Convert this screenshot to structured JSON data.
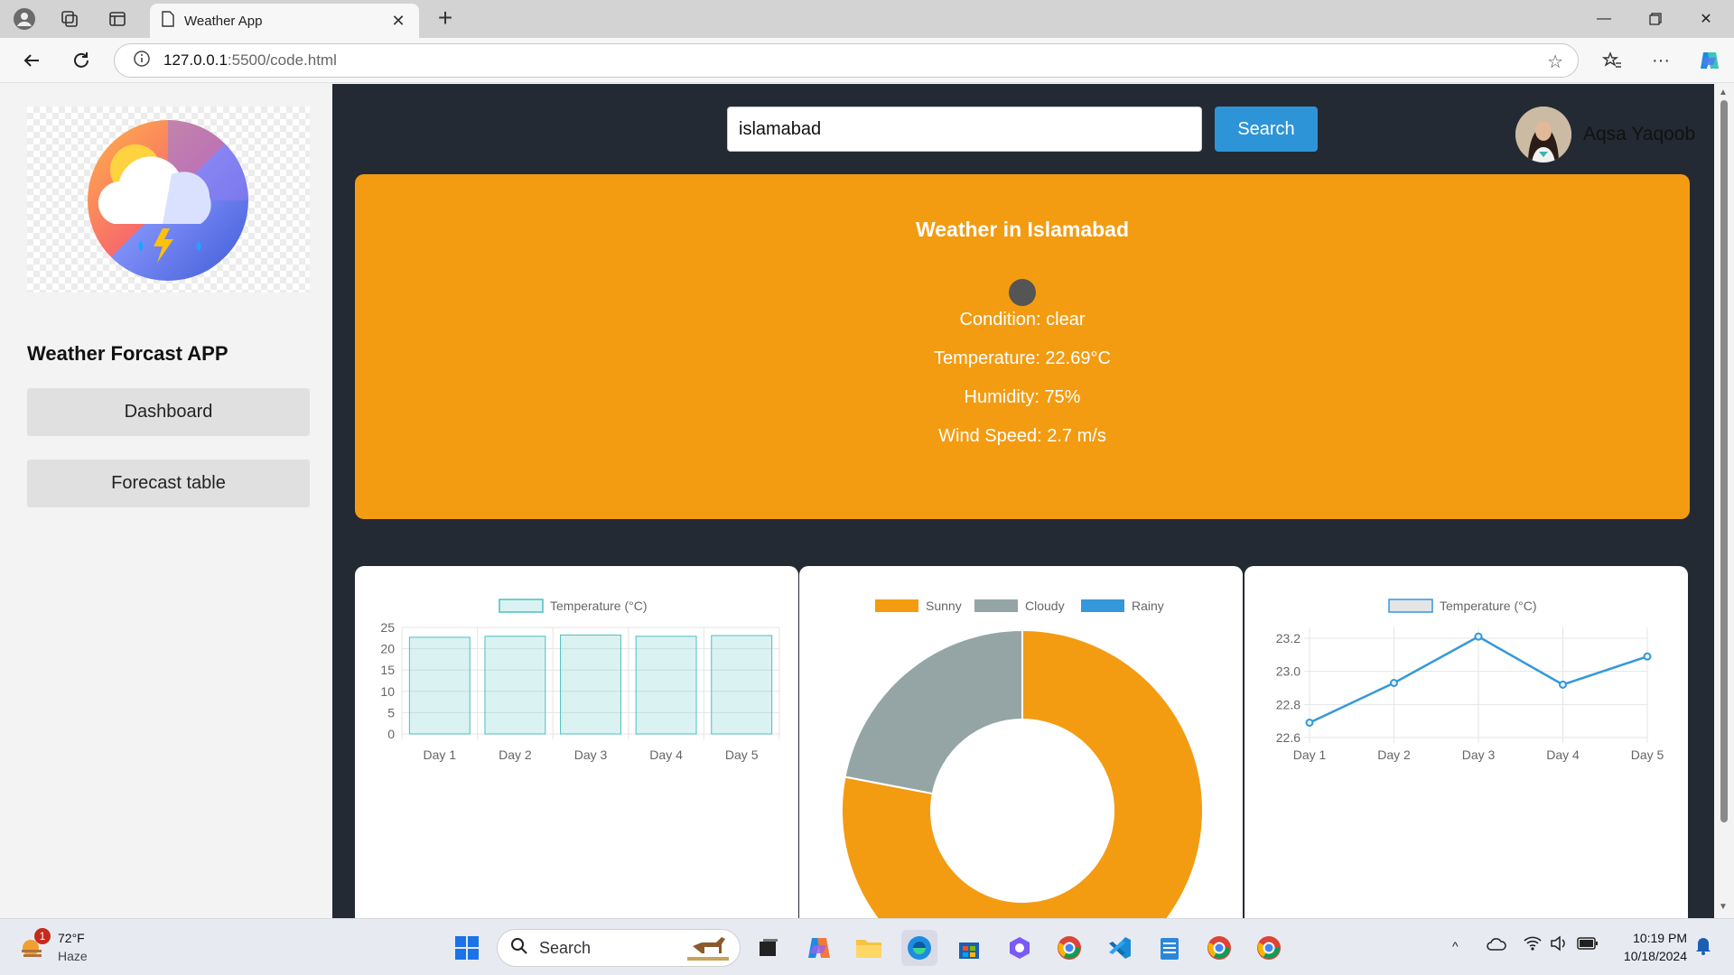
{
  "browser": {
    "tab_title": "Weather App",
    "url_host": "127.0.0.1",
    "url_path": ":5500/code.html"
  },
  "sidebar": {
    "app_title": "Weather Forcast APP",
    "nav": [
      {
        "label": "Dashboard"
      },
      {
        "label": "Forecast table"
      }
    ]
  },
  "header": {
    "search_value": "islamabad",
    "search_button": "Search",
    "user_name": "Aqsa Yaqoob"
  },
  "weather": {
    "title": "Weather in Islamabad",
    "condition": "Condition: clear",
    "temperature": "Temperature: 22.69°C",
    "humidity": "Humidity: 75%",
    "wind": "Wind Speed: 2.7 m/s",
    "card_color": "#f39c12"
  },
  "chart_data": [
    {
      "type": "bar",
      "legend": [
        "Temperature (°C)"
      ],
      "categories": [
        "Day 1",
        "Day 2",
        "Day 3",
        "Day 4",
        "Day 5"
      ],
      "series": [
        {
          "name": "Temperature (°C)",
          "values": [
            22.69,
            22.93,
            23.21,
            22.92,
            23.09
          ]
        }
      ],
      "ylim": [
        0,
        25
      ],
      "yticks": [
        0,
        5,
        10,
        15,
        20,
        25
      ],
      "color": "#4bc0c0"
    },
    {
      "type": "pie",
      "variant": "doughnut",
      "legend": [
        "Sunny",
        "Cloudy",
        "Rainy"
      ],
      "values": [
        78,
        22,
        0
      ],
      "colors": [
        "#f39c12",
        "#95a5a6",
        "#3498db"
      ]
    },
    {
      "type": "line",
      "legend": [
        "Temperature (°C)"
      ],
      "x": [
        "Day 1",
        "Day 2",
        "Day 3",
        "Day 4",
        "Day 5"
      ],
      "series": [
        {
          "name": "Temperature (°C)",
          "values": [
            22.69,
            22.93,
            23.21,
            22.92,
            23.09
          ]
        }
      ],
      "ylim": [
        22.6,
        23.2
      ],
      "yticks": [
        "22.6",
        "22.8",
        "23.0",
        "23.2"
      ],
      "color": "#3498db"
    }
  ],
  "taskbar": {
    "weather_temp": "72°F",
    "weather_desc": "Haze",
    "weather_badge": "1",
    "search_placeholder": "Search",
    "time": "10:19 PM",
    "date": "10/18/2024"
  }
}
